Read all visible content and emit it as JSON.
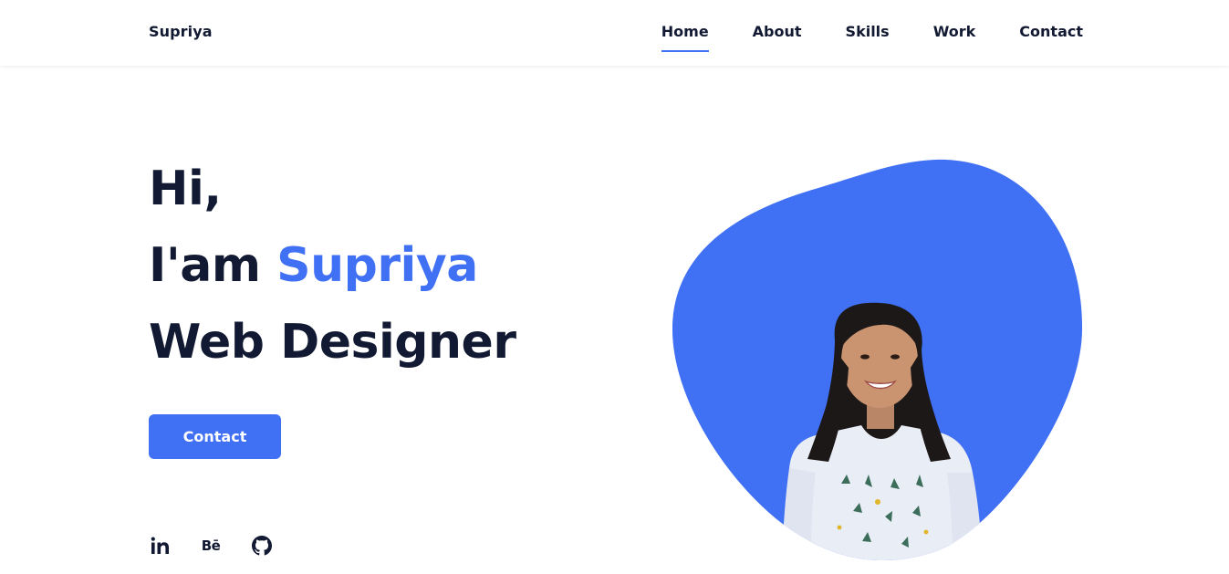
{
  "header": {
    "logo": "Supriya",
    "nav": [
      {
        "label": "Home",
        "active": true
      },
      {
        "label": "About",
        "active": false
      },
      {
        "label": "Skills",
        "active": false
      },
      {
        "label": "Work",
        "active": false
      },
      {
        "label": "Contact",
        "active": false
      }
    ]
  },
  "hero": {
    "line1": "Hi,",
    "line2_prefix": "I'am ",
    "line2_name": "Supriya",
    "line3": "Web Designer",
    "button_label": "Contact"
  },
  "social": {
    "linkedin_text": "in",
    "behance_text": "Bē",
    "icons": [
      "linkedin-icon",
      "behance-icon",
      "github-icon"
    ]
  },
  "colors": {
    "accent": "#4070f4",
    "text": "#121a33"
  }
}
